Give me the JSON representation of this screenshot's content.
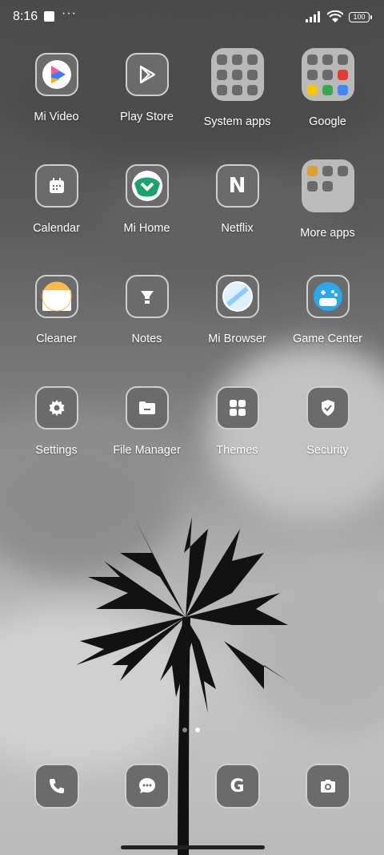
{
  "status": {
    "time": "8:16",
    "more": "···",
    "battery": "100"
  },
  "row1": [
    {
      "label": "Mi Video",
      "icon": "mi-video-icon"
    },
    {
      "label": "Play Store",
      "icon": "play-store-icon"
    },
    {
      "label": "System apps",
      "icon": "system-apps-folder-icon"
    },
    {
      "label": "Google",
      "icon": "google-folder-icon"
    }
  ],
  "row2": [
    {
      "label": "Calendar",
      "icon": "calendar-icon"
    },
    {
      "label": "Mi Home",
      "icon": "mi-home-icon"
    },
    {
      "label": "Netflix",
      "icon": "netflix-icon",
      "glyph": "N"
    },
    {
      "label": "More apps",
      "icon": "more-apps-folder-icon"
    }
  ],
  "row3": [
    {
      "label": "Cleaner",
      "icon": "cleaner-icon"
    },
    {
      "label": "Notes",
      "icon": "notes-icon"
    },
    {
      "label": "Mi Browser",
      "icon": "mi-browser-icon"
    },
    {
      "label": "Game Center",
      "icon": "game-center-icon"
    }
  ],
  "row4": [
    {
      "label": "Settings",
      "icon": "gear-icon"
    },
    {
      "label": "File Manager",
      "icon": "folder-icon"
    },
    {
      "label": "Themes",
      "icon": "themes-icon"
    },
    {
      "label": "Security",
      "icon": "shield-icon"
    }
  ],
  "dock": [
    {
      "icon": "phone-icon"
    },
    {
      "icon": "messages-icon"
    },
    {
      "icon": "google-icon",
      "glyph": "G"
    },
    {
      "icon": "camera-icon"
    }
  ],
  "colors": {
    "tile": "#6b6b6b",
    "tile_border": "#cfcfcf",
    "folder": "#cdcdcd",
    "page_dot_active": "#ffffff"
  }
}
